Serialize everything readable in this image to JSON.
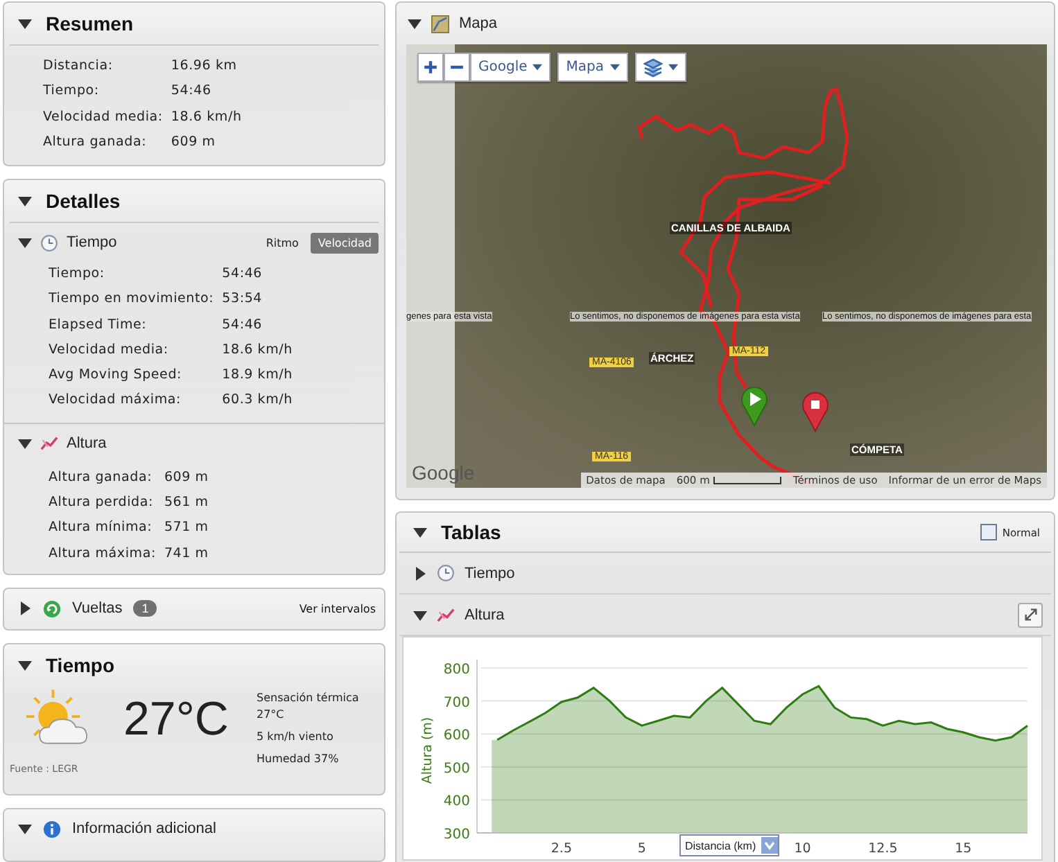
{
  "summary": {
    "title": "Resumen",
    "expanded": true,
    "rows": [
      {
        "label": "Distancia:",
        "value": "16.96 km"
      },
      {
        "label": "Tiempo:",
        "value": "54:46"
      },
      {
        "label": "Velocidad media:",
        "value": "18.6 km/h"
      },
      {
        "label": "Altura ganada:",
        "value": "609 m"
      }
    ]
  },
  "details": {
    "title": "Detalles",
    "expanded": true,
    "sections": [
      {
        "kind": "time",
        "title": "Tiempo",
        "expanded": true,
        "toggles": [
          {
            "label": "Ritmo",
            "selected": false
          },
          {
            "label": "Velocidad",
            "selected": true
          }
        ],
        "rows": [
          {
            "label": "Tiempo:",
            "value": "54:46"
          },
          {
            "label": "Tiempo en movimiento:",
            "value": "53:54"
          },
          {
            "label": "Elapsed Time:",
            "value": "54:46"
          },
          {
            "label": "Velocidad media:",
            "value": "18.6 km/h"
          },
          {
            "label": "Avg Moving Speed:",
            "value": "18.9 km/h"
          },
          {
            "label": "Velocidad máxima:",
            "value": "60.3 km/h"
          }
        ]
      },
      {
        "kind": "elevation",
        "title": "Altura",
        "expanded": true,
        "rows": [
          {
            "label": "Altura ganada:",
            "value": "609 m"
          },
          {
            "label": "Altura perdida:",
            "value": "561 m"
          },
          {
            "label": "Altura mínima:",
            "value": "571 m"
          },
          {
            "label": "Altura máxima:",
            "value": "741 m"
          }
        ]
      }
    ]
  },
  "laps": {
    "title": "Vueltas",
    "expanded": false,
    "count": "1",
    "link": "Ver intervalos"
  },
  "weather": {
    "title": "Tiempo",
    "expanded": true,
    "temperature": "27°C",
    "feels_like_label": "Sensación térmica",
    "feels_like": "27°C",
    "wind": "5 km/h viento",
    "humidity": "Humedad 37%",
    "source": "Fuente : LEGR"
  },
  "additional_info": {
    "title": "Información adicional",
    "expanded": true
  },
  "map": {
    "title": "Mapa",
    "expanded": true,
    "provider": "Google",
    "map_type": "Mapa",
    "logo": "Google",
    "no_imagery_notices": [
      "genes para esta vista",
      "Lo sentimos, no disponemos de imágenes para esta vista",
      "Lo sentimos, no disponemos de imágenes para esta"
    ],
    "places": [
      {
        "label": "CANILLAS DE ALBAIDA",
        "kind": "town"
      },
      {
        "label": "ÁRCHEZ",
        "kind": "town"
      },
      {
        "label": "CÓMPETA",
        "kind": "town"
      },
      {
        "label": "MA-4106",
        "kind": "road"
      },
      {
        "label": "MA-112",
        "kind": "road"
      },
      {
        "label": "MA-116",
        "kind": "road"
      }
    ],
    "footer": {
      "data": "Datos de mapa",
      "scale": "600 m",
      "terms": "Términos de uso",
      "report": "Informar de un error de Maps"
    }
  },
  "tables": {
    "title": "Tablas",
    "expanded": true,
    "normal": {
      "label": "Normal",
      "checked": false
    },
    "sections": [
      {
        "title": "Tiempo",
        "kind": "time",
        "expanded": false
      },
      {
        "title": "Altura",
        "kind": "elevation",
        "expanded": true
      }
    ],
    "chart_data": {
      "type": "area",
      "xlabel": "Distancia (km)",
      "ylabel": "Altura (m)",
      "x": [
        0.5,
        1,
        1.5,
        2,
        2.5,
        3,
        3.5,
        4,
        4.5,
        5,
        5.5,
        6,
        6.5,
        7,
        7.5,
        8,
        8.5,
        9,
        9.5,
        10,
        10.5,
        11,
        11.5,
        12,
        12.5,
        13,
        13.5,
        14,
        14.5,
        15,
        15.5,
        16,
        16.5,
        17
      ],
      "series": [
        {
          "color": "#2e7d12",
          "values": [
            582,
            611,
            637,
            664,
            697,
            710,
            740,
            700,
            650,
            625,
            640,
            655,
            650,
            700,
            740,
            690,
            640,
            630,
            680,
            720,
            745,
            680,
            650,
            645,
            625,
            640,
            630,
            635,
            615,
            605,
            590,
            580,
            590,
            625
          ]
        }
      ],
      "xlim": [
        0,
        17
      ],
      "ylim": [
        300,
        800
      ],
      "xticks": [
        2.5,
        5,
        10,
        12.5,
        15
      ],
      "yticks": [
        300,
        400,
        500,
        600,
        700,
        800
      ],
      "grid": true
    }
  }
}
